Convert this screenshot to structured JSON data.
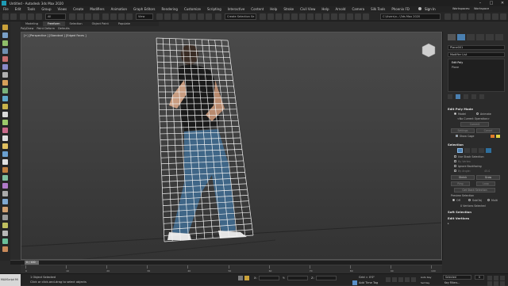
{
  "app": {
    "title": "Untitled - Autodesk 3ds Max 2020",
    "window_controls": {
      "minimize": "–",
      "maximize": "□",
      "close": "✕"
    }
  },
  "menu": {
    "items": [
      "File",
      "Edit",
      "Tools",
      "Group",
      "Views",
      "Create",
      "Modifiers",
      "Animation",
      "Graph Editors",
      "Rendering",
      "Customize",
      "Scripting",
      "Interactive",
      "Content",
      "Help",
      "Stroke",
      "Civil View",
      "Help",
      "Arnold",
      "Camera",
      "Silk Tools",
      "Phoenix FD"
    ],
    "sign_in": "Sign In",
    "workspaces_label": "Workspaces:",
    "workspace_value": "Workspace"
  },
  "toolbar": {
    "filter_value": "All",
    "view_value": "View",
    "selection_set_placeholder": "Create Selection Se",
    "project_path": "C:\\Users\\n...\\3ds Max 2020"
  },
  "ribbon": {
    "tabs": [
      "Modeling",
      "Freeform",
      "Selection",
      "Object Paint",
      "Populate"
    ],
    "active_tab": "Freeform",
    "sub_items": [
      "PolyDraw",
      "Paint Deform",
      "Defaults"
    ]
  },
  "viewport": {
    "label": "[+] [Perspective ] [Standard ] [Edged Faces ]"
  },
  "command_panel": {
    "object_name": "Plane001",
    "modifier_list": "Modifier List",
    "stack": [
      "Edit Poly",
      "Plane"
    ],
    "edit_poly_mode": {
      "heading": "Edit Poly Mode",
      "model": "Model",
      "animate": "Animate",
      "no_operation": "<No Current Operation>",
      "commit": "Commit",
      "settings": "Settings",
      "cancel": "Cancel",
      "show_cage": "Show Cage"
    },
    "selection": {
      "heading": "Selection",
      "use_stack": "Use Stack Selection",
      "by_vertex": "By Vertex",
      "ignore_backfacing": "Ignore Backfacing",
      "by_angle": "By Angle:",
      "angle_value": "45.0",
      "shrink": "Shrink",
      "grow": "Grow",
      "ring": "Ring",
      "loop": "Loop",
      "get_stack_selection": "Get Stack Selection",
      "preview_selection": "Preview Selection",
      "off": "Off",
      "subobj": "SubObj",
      "multi": "Multi",
      "vertices_selected": "0 Vertices Selected"
    },
    "soft_selection": "Soft Selection",
    "edit_vertices": "Edit Vertices"
  },
  "timeline": {
    "frame_label": "0 / 100",
    "ticks": [
      "0",
      "10",
      "20",
      "30",
      "40",
      "50",
      "60",
      "70",
      "80",
      "90",
      "100"
    ]
  },
  "status": {
    "maxscript": "MAXScript Mi",
    "objects_selected": "1 Object Selected",
    "prompt": "Click or click-and-drag to select objects",
    "x_label": "X:",
    "y_label": "Y:",
    "z_label": "Z:",
    "grid": "Grid = 0'0\"",
    "add_time_tag": "Add Time Tag",
    "auto_key": "Auto Key",
    "selected": "Selected",
    "set_key": "Set Key",
    "key_filters": "Key Filters...",
    "frame": "0"
  },
  "colors": {
    "grid_lines": "#f2f2f2",
    "viewport_bg": "#464646",
    "accent": "#6fa8dc"
  }
}
